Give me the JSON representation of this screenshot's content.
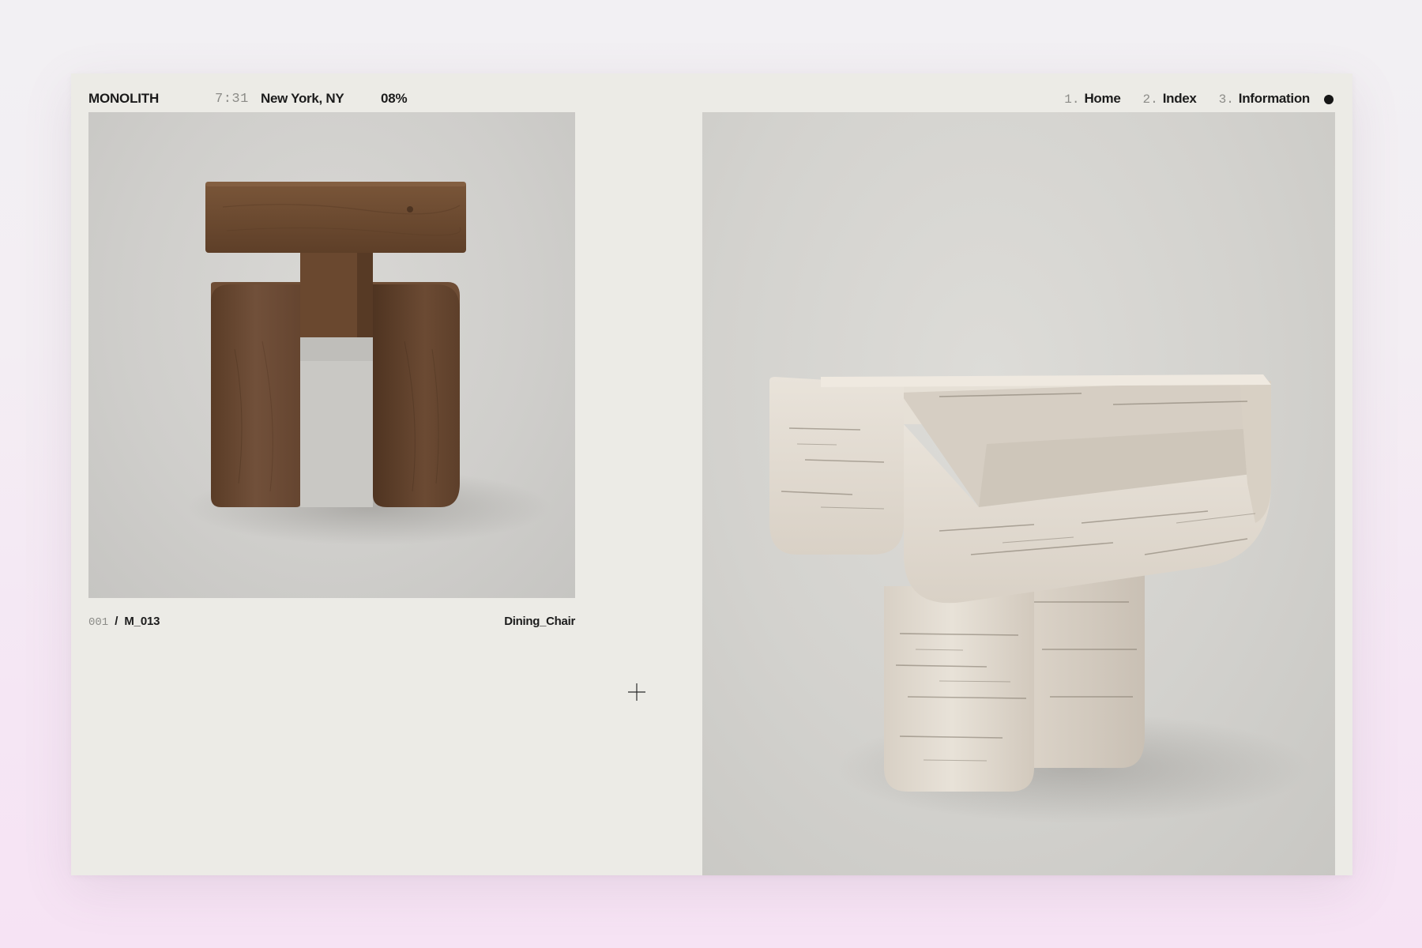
{
  "header": {
    "brand": "MONOLITH",
    "time": "7:31",
    "location": "New York, NY",
    "progress": "08%"
  },
  "nav": {
    "items": [
      {
        "number": "1.",
        "label": "Home"
      },
      {
        "number": "2.",
        "label": "Index"
      },
      {
        "number": "3.",
        "label": "Information"
      }
    ]
  },
  "product": {
    "index": "001",
    "separator": "/",
    "code": "M_013",
    "name": "Dining_Chair"
  },
  "icons": {
    "cursor": "crosshair-plus-icon",
    "status": "status-dot-icon"
  },
  "colors": {
    "page_background": "#ecebe6",
    "text": "#1c1c1c",
    "muted_text": "#8c8c88",
    "wood": "#6b4a33",
    "travertine": "#e4ddd3"
  }
}
